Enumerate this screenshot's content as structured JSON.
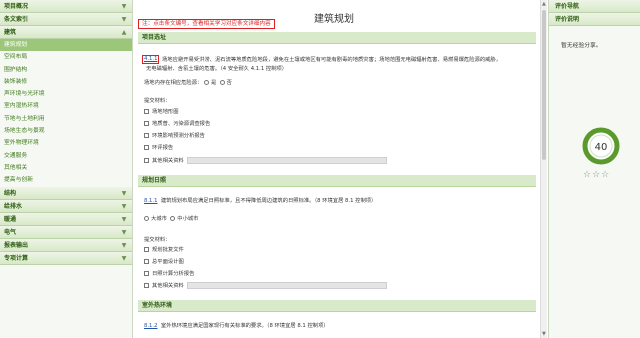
{
  "sidebar": {
    "sections": [
      {
        "label": "项目概况"
      },
      {
        "label": "条文索引"
      },
      {
        "label": "建筑",
        "items": [
          "建筑规划",
          "空间布局",
          "围护结构",
          "装饰装修",
          "声环境与光环境",
          "室内湿热环境",
          "节地与土地利用",
          "场地生态与景观",
          "室外物理环境",
          "交通服务",
          "其他相关",
          "提高与创新"
        ],
        "active_index": 0
      },
      {
        "label": "结构"
      },
      {
        "label": "给排水"
      },
      {
        "label": "暖通"
      },
      {
        "label": "电气"
      },
      {
        "label": "报表输出"
      },
      {
        "label": "专项计算"
      }
    ]
  },
  "main": {
    "title": "建筑规划",
    "notice": "注：点击条文编号，查看相关学习对应条文详细内容",
    "sections": [
      {
        "header": "项目选址",
        "clause_code": "4.1.1",
        "clause_text": "场地应避开易受洪涝、泥石流等地质危险地段，避免在土壤或地区有可能有剧毒的地质灾害；场地范围无电磁辐射危害、易燃易爆危险源的威胁，",
        "clause_text2": "无电磁辐射、含氡土壤的危害。（4 安全耐久  4.1.1 控制项）",
        "question": "场地内存在相应危险源：",
        "yes_label": "是",
        "no_label": "否",
        "materials_label": "提交材料：",
        "materials": [
          "场地地形图",
          "地质普、污染源调查报告",
          "环境影响预测分析报告",
          "环评报告"
        ],
        "other_label": "其他相关资料"
      },
      {
        "header": "规划日照",
        "clause_code": "8.1.1",
        "clause_text": "建筑规划布局应满足日照标准，且不得降低周边建筑的日照标准。（8 环境宜居 8.1 控制项）",
        "city_large": "大城市",
        "city_small": "中小城市",
        "materials_label": "提交材料：",
        "materials": [
          "规划批复文件",
          "总平面设计图",
          "日照计算分析报告"
        ],
        "other_label": "其他相关资料"
      },
      {
        "header": "室外热环境",
        "clause_code": "8.1.2",
        "clause_text": "室外热环境应满足国家现行有关标准的要求。（8 环境宜居 8.1 控制项）"
      }
    ]
  },
  "right_panel": {
    "nav_header": "评价导航",
    "notes_header": "评价说明",
    "notes_text": "暂无经验分享。",
    "score": "40",
    "score_color": "#5a9a2c",
    "stars_total": 3
  }
}
